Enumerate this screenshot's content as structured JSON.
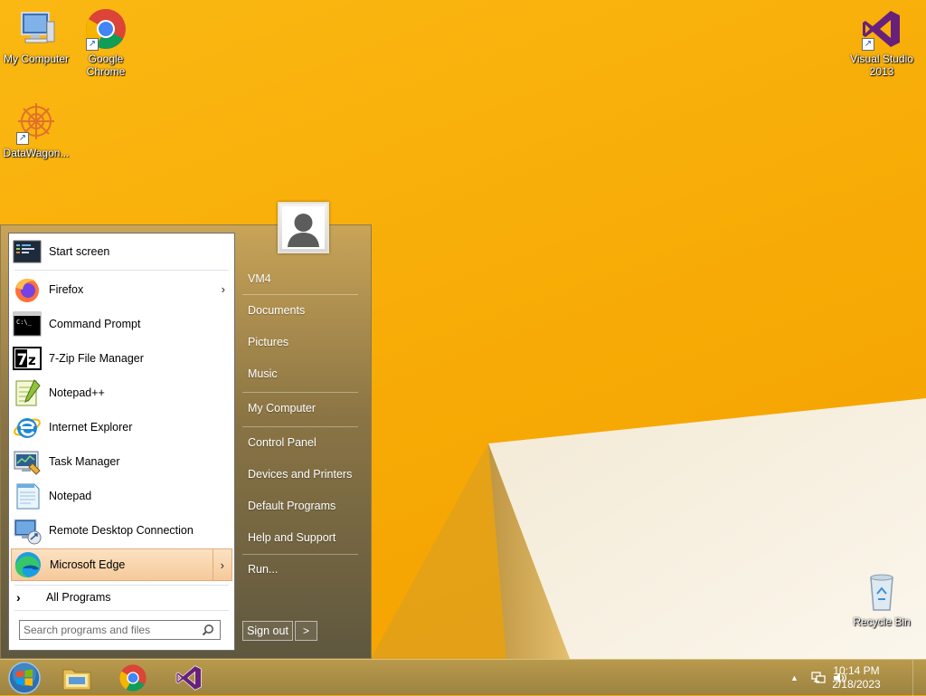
{
  "desktop": {
    "icons": [
      {
        "label": "My Computer",
        "icon": "computer-icon"
      },
      {
        "label": "Google Chrome",
        "icon": "chrome-icon"
      },
      {
        "label": "DataWagon...",
        "icon": "datawagon-icon"
      },
      {
        "label": "Visual Studio 2013",
        "icon": "visual-studio-icon"
      },
      {
        "label": "Recycle Bin",
        "icon": "recycle-bin-icon"
      }
    ]
  },
  "start_menu": {
    "left_items": [
      {
        "label": "Start screen",
        "icon": "start-screen-icon"
      },
      {
        "label": "Firefox",
        "icon": "firefox-icon",
        "has_submenu": true
      },
      {
        "label": "Command Prompt",
        "icon": "command-prompt-icon"
      },
      {
        "label": "7-Zip File Manager",
        "icon": "7zip-icon"
      },
      {
        "label": "Notepad++",
        "icon": "notepad-plus-plus-icon"
      },
      {
        "label": "Internet Explorer",
        "icon": "internet-explorer-icon"
      },
      {
        "label": "Task Manager",
        "icon": "task-manager-icon"
      },
      {
        "label": "Notepad",
        "icon": "notepad-icon"
      },
      {
        "label": "Remote Desktop Connection",
        "icon": "remote-desktop-icon"
      },
      {
        "label": "Microsoft Edge",
        "icon": "edge-icon",
        "has_submenu": true,
        "highlighted": true
      }
    ],
    "all_programs": "All Programs",
    "search": {
      "placeholder": "Search programs and files",
      "value": ""
    },
    "right_links": [
      "VM4",
      "Documents",
      "Pictures",
      "Music",
      "My Computer",
      "Control Panel",
      "Devices and Printers",
      "Default Programs",
      "Help and Support",
      "Run..."
    ],
    "sign_out": "Sign out",
    "sign_out_arrow": ">"
  },
  "taskbar": {
    "pinned": [
      "start-orb-icon",
      "file-explorer-icon",
      "chrome-icon",
      "visual-studio-icon"
    ],
    "tray_icons": [
      "show-hidden-icons-icon",
      "network-icon",
      "volume-icon"
    ],
    "clock": {
      "time": "10:14 PM",
      "date": "2/18/2023"
    }
  },
  "colors": {
    "wallpaper": "#f7aa05",
    "menu_highlight": "#f6c99a",
    "taskbar": "#a98c46"
  }
}
